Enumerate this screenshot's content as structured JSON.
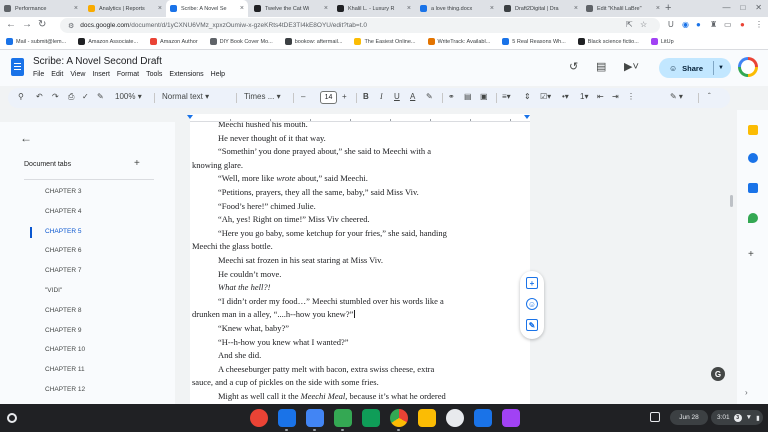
{
  "browser": {
    "tabs": [
      {
        "title": "Performance",
        "color": "#5f6368"
      },
      {
        "title": "Analytics | Reports",
        "color": "#f9ab00"
      },
      {
        "title": "Scribe: A Novel Se",
        "color": "#1a73e8"
      },
      {
        "title": "Twelve the Cat Wi",
        "color": "#202124"
      },
      {
        "title": "Khalil L. - Luxury R",
        "color": "#202124"
      },
      {
        "title": "a love thing.docx",
        "color": "#1a73e8"
      },
      {
        "title": "Draft2Digital | Dra",
        "color": "#3c4043"
      },
      {
        "title": "Edit \"Khalil LaBre\"",
        "color": "#5f6368"
      }
    ],
    "url_host": "docs.google.com",
    "url_path": "/document/d/1yCXNU6VMz_xpxzOumiw-x-gzeKRts4tDE3TI4kE8OYU/edit?tab=t.0",
    "bookmarks": [
      {
        "label": "Mail - submit@lem...",
        "color": "#1a73e8"
      },
      {
        "label": "Amazon Associate...",
        "color": "#202124"
      },
      {
        "label": "Amazon Author",
        "color": "#ea4335"
      },
      {
        "label": "DIY Book Cover Mo...",
        "color": "#5f6368"
      },
      {
        "label": "bookow: aftermail...",
        "color": "#3c4043"
      },
      {
        "label": "The Easiest Online...",
        "color": "#fbbc04"
      },
      {
        "label": "WriteTrack: Availabl...",
        "color": "#e37400"
      },
      {
        "label": "5 Real Reasons Wh...",
        "color": "#1a73e8"
      },
      {
        "label": "Black science fictio...",
        "color": "#202124"
      },
      {
        "label": "LitUp",
        "color": "#a142f4"
      }
    ]
  },
  "doc": {
    "title": "Scribe: A Novel Second Draft",
    "menu": [
      "File",
      "Edit",
      "View",
      "Insert",
      "Format",
      "Tools",
      "Extensions",
      "Help"
    ],
    "share_label": "Share",
    "toolbar": {
      "zoom": "100%",
      "style": "Normal text",
      "font": "Times ...",
      "font_size": "14"
    }
  },
  "sidebar": {
    "header": "Document tabs",
    "tabs": [
      {
        "label": "CHAPTER 3",
        "active": false
      },
      {
        "label": "CHAPTER 4",
        "active": false
      },
      {
        "label": "CHAPTER 5",
        "active": true
      },
      {
        "label": "CHAPTER 6",
        "active": false
      },
      {
        "label": "CHAPTER 7",
        "active": false
      },
      {
        "label": "\"VIDI\"",
        "active": false
      },
      {
        "label": "CHAPTER 8",
        "active": false
      },
      {
        "label": "CHAPTER 9",
        "active": false
      },
      {
        "label": "CHAPTER 10",
        "active": false
      },
      {
        "label": "CHAPTER 11",
        "active": false
      },
      {
        "label": "CHAPTER 12",
        "active": false
      }
    ]
  },
  "content": {
    "lines": [
      {
        "text": "Meechi hushed his mouth.",
        "indent": true
      },
      {
        "text": "He never thought of it that way.",
        "indent": true
      },
      {
        "text": "“Somethin’ you done prayed about,” she said to Meechi with a",
        "indent": true
      },
      {
        "text": "knowing glare.",
        "indent": false
      },
      {
        "text": "“Well, more like wrote about,” said Meechi.",
        "indent": true
      },
      {
        "text": "“Petitions, prayers, they all the same, baby,” said Miss Viv.",
        "indent": true
      },
      {
        "text": "“Food’s here!” chimed Julie.",
        "indent": true
      },
      {
        "text": "“Ah, yes! Right on time!” Miss Viv cheered.",
        "indent": true
      },
      {
        "text": "“Here you go baby, some ketchup for your fries,” she said, handing",
        "indent": true
      },
      {
        "text": "Meechi the glass bottle.",
        "indent": false
      },
      {
        "text": "Meechi sat frozen in his seat staring at Miss Viv.",
        "indent": true
      },
      {
        "text": "He couldn’t move.",
        "indent": true
      },
      {
        "text": "What the hell?!",
        "indent": true
      },
      {
        "text": "“I didn’t order my food…” Meechi stumbled over his words like a",
        "indent": true
      },
      {
        "text": "drunken man in a alley, “....h--how you knew?”",
        "indent": false
      },
      {
        "text": "“Knew what, baby?”",
        "indent": true
      },
      {
        "text": "“H--h-how you knew what I wanted?”",
        "indent": true
      },
      {
        "text": "And she did.",
        "indent": true
      },
      {
        "text": "A cheeseburger patty melt with bacon, extra swiss cheese, extra",
        "indent": true
      },
      {
        "text": "sauce, and a cup of pickles on the side with some fries.",
        "indent": false
      },
      {
        "text": "Might as well call it the Meechi Meal, because it’s what he ordered",
        "indent": true
      }
    ]
  },
  "taskbar": {
    "date": "Jun 28",
    "time": "3:01",
    "notif_count": "3"
  }
}
